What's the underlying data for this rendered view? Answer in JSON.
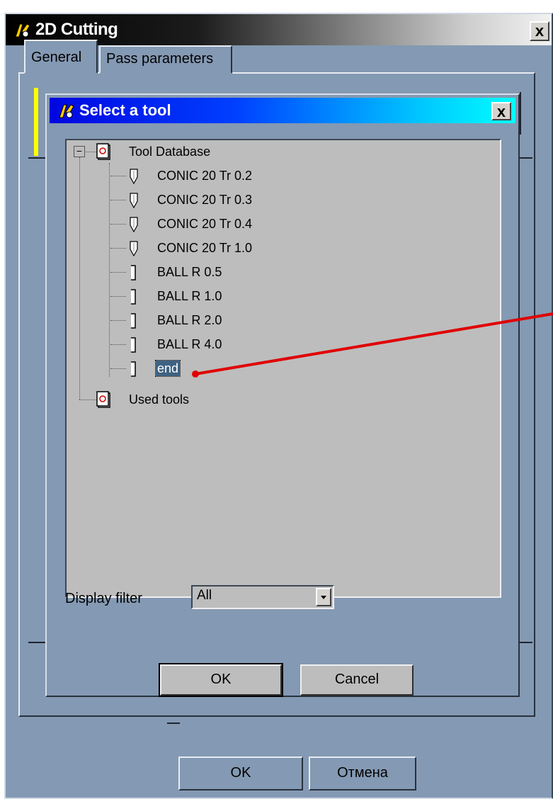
{
  "outer_window": {
    "title": "2D Cutting",
    "close_label": "x",
    "tabs": [
      {
        "label": "General"
      },
      {
        "label": "Pass parameters"
      }
    ],
    "ok_label": "OK",
    "cancel_label": "Отмена"
  },
  "dialog": {
    "title": "Select a tool",
    "close_label": "x",
    "expander_symbol": "−",
    "tree": {
      "root_label": "Tool Database",
      "items": [
        {
          "label": "CONIC 20 Tr 0.2",
          "icon": "conic-tool-icon"
        },
        {
          "label": "CONIC 20 Tr 0.3",
          "icon": "conic-tool-icon"
        },
        {
          "label": "CONIC 20 Tr 0.4",
          "icon": "conic-tool-icon"
        },
        {
          "label": "CONIC 20 Tr 1.0",
          "icon": "conic-tool-icon"
        },
        {
          "label": "BALL R 0.5",
          "icon": "ball-tool-icon"
        },
        {
          "label": "BALL R 1.0",
          "icon": "ball-tool-icon"
        },
        {
          "label": "BALL R 2.0",
          "icon": "ball-tool-icon"
        },
        {
          "label": "BALL R 4.0",
          "icon": "ball-tool-icon"
        },
        {
          "label": "end",
          "icon": "end-tool-icon",
          "selected": true
        }
      ],
      "used_label": "Used tools"
    },
    "filter": {
      "label": "Display filter",
      "value": "All"
    },
    "ok_label": "OK",
    "cancel_label": "Cancel"
  },
  "colors": {
    "window_bg": "#8499b3",
    "dialog_title_start": "#0006e0",
    "dialog_title_end": "#00ffff",
    "tree_bg": "#bdbdbd",
    "selection": "#3e6282",
    "annotation_arrow": "#e00000",
    "highlight_marker": "#ffff00"
  }
}
